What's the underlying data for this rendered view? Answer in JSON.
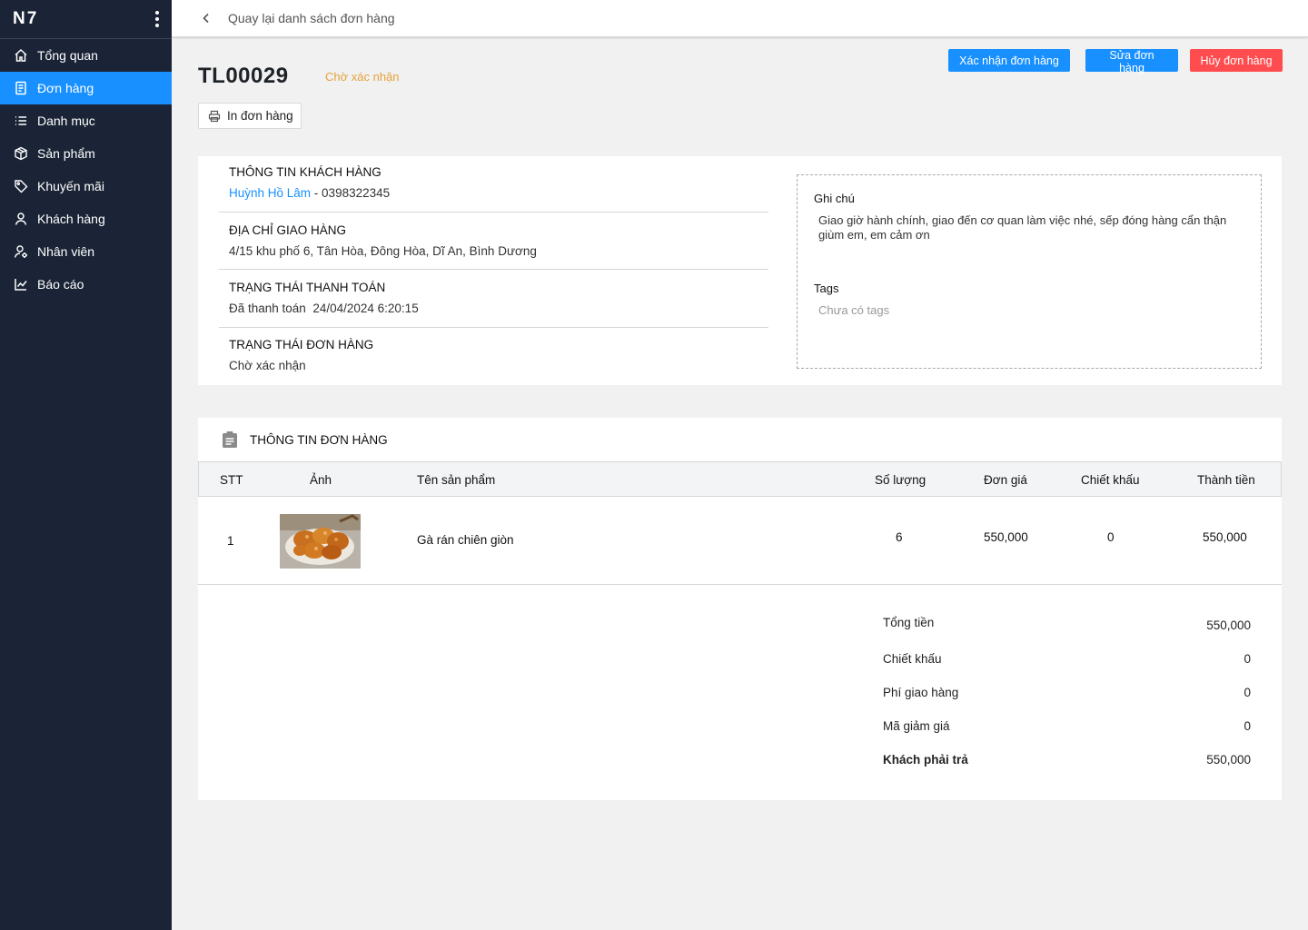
{
  "sidebar": {
    "brand": "N7",
    "items": [
      {
        "label": "Tổng quan",
        "icon": "home-icon",
        "active": false
      },
      {
        "label": "Đơn hàng",
        "icon": "document-icon",
        "active": true
      },
      {
        "label": "Danh mục",
        "icon": "list-icon",
        "active": false
      },
      {
        "label": "Sản phẩm",
        "icon": "box-icon",
        "active": false
      },
      {
        "label": "Khuyến mãi",
        "icon": "tag-icon",
        "active": false
      },
      {
        "label": "Khách hàng",
        "icon": "user-icon",
        "active": false
      },
      {
        "label": "Nhân viên",
        "icon": "user-gear-icon",
        "active": false
      },
      {
        "label": "Báo cáo",
        "icon": "chart-icon",
        "active": false
      }
    ]
  },
  "topbar": {
    "back_label": "Quay lại danh sách đơn hàng"
  },
  "order": {
    "code": "TL00029",
    "status": "Chờ xác nhận",
    "actions": {
      "confirm": "Xác nhận đơn hàng",
      "edit": "Sửa đơn hàng",
      "cancel": "Hủy đơn hàng",
      "print": "In đơn hàng"
    }
  },
  "customer": {
    "section_title": "THÔNG TIN KHÁCH HÀNG",
    "name": "Huỳnh Hồ Lâm",
    "separator": " - ",
    "phone": "0398322345"
  },
  "shipping": {
    "section_title": "ĐỊA CHỈ GIAO HÀNG",
    "address": "4/15 khu phố 6, Tân Hòa, Đông Hòa, Dĩ An, Bình Dương"
  },
  "payment": {
    "section_title": "TRẠNG THÁI THANH TOÁN",
    "status": "Đã thanh toán",
    "time": "24/04/2024 6:20:15"
  },
  "order_status": {
    "section_title": "TRẠNG THÁI ĐƠN HÀNG",
    "status": "Chờ xác nhận"
  },
  "note": {
    "title": "Ghi chú",
    "text": "Giao giờ hành chính, giao đến cơ quan làm việc nhé, sếp đóng hàng cẩn thận giùm em, em cảm ơn",
    "tags_title": "Tags",
    "tags_empty": "Chưa có tags"
  },
  "order_info": {
    "title": "THÔNG TIN ĐƠN HÀNG",
    "columns": [
      "STT",
      "Ảnh",
      "Tên sản phẩm",
      "Số lượng",
      "Đơn giá",
      "Chiết khấu",
      "Thành tiền"
    ],
    "rows": [
      {
        "stt": "1",
        "image": "fried-chicken-photo",
        "name": "Gà rán chiên giòn",
        "qty": "6",
        "price": "550,000",
        "discount": "0",
        "total": "550,000"
      }
    ]
  },
  "summary": {
    "items": [
      {
        "label": "Tổng tiền",
        "value": "550,000"
      },
      {
        "label": "Chiết khấu",
        "value": "0"
      },
      {
        "label": "Phí giao hàng",
        "value": "0"
      },
      {
        "label": "Mã giảm giá",
        "value": "0"
      },
      {
        "label": "Khách phải trả",
        "value": "550,000"
      }
    ]
  },
  "colors": {
    "sidebar_bg": "#1a2436",
    "accent": "#1890ff",
    "danger": "#ff4d4f",
    "status_pending": "#e6a23c"
  }
}
